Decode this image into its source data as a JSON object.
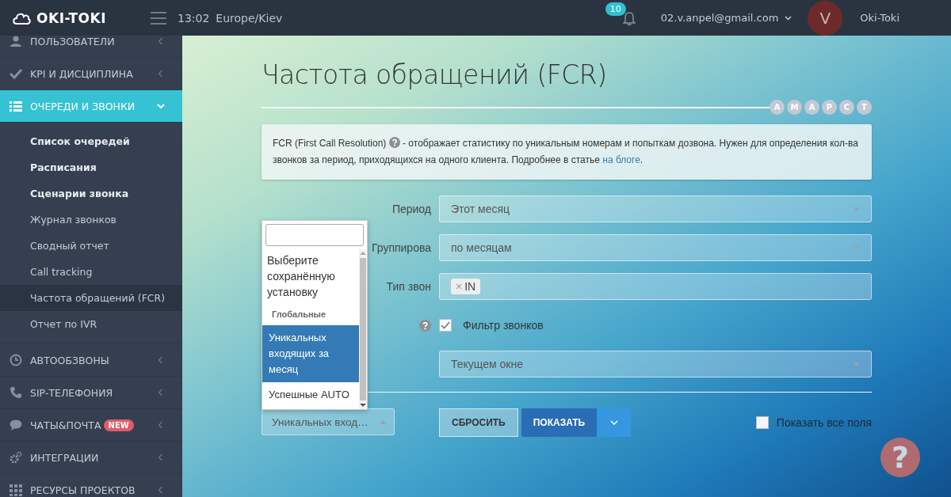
{
  "header": {
    "logo": "OKI-TOKI",
    "time": "13:02",
    "timezone": "Europe/Kiev",
    "notifications": "10",
    "email": "02.v.anpel@gmail.com",
    "avatar_letter": "V",
    "account": "Oki-Toki"
  },
  "sidebar": {
    "items": [
      {
        "label": "ПОЛЬЗОВАТЕЛИ",
        "expanded": false,
        "selected": false
      },
      {
        "label": "KPI И ДИСЦИПЛИНА",
        "expanded": false,
        "selected": false
      },
      {
        "label": "ОЧЕРЕДИ И ЗВОНКИ",
        "expanded": true,
        "selected": true,
        "children": [
          {
            "label": "Список очередей",
            "bold": true,
            "selected": false
          },
          {
            "label": "Расписания",
            "bold": true,
            "selected": false
          },
          {
            "label": "Сценарии звонка",
            "bold": true,
            "selected": false
          },
          {
            "label": "Журнал звонков",
            "bold": false,
            "selected": false
          },
          {
            "label": "Сводный отчет",
            "bold": false,
            "selected": false
          },
          {
            "label": "Call tracking",
            "bold": false,
            "selected": false
          },
          {
            "label": "Частота обращений (FCR)",
            "bold": false,
            "selected": true
          },
          {
            "label": "Отчет по IVR",
            "bold": false,
            "selected": false
          }
        ]
      },
      {
        "label": "АВТООБЗВОНЫ",
        "expanded": false,
        "selected": false
      },
      {
        "label": "SIP-ТЕЛЕФОНИЯ",
        "expanded": false,
        "selected": false
      },
      {
        "label": "ЧАТЫ&ПОЧТА",
        "badge": "NEW",
        "expanded": false,
        "selected": false
      },
      {
        "label": "ИНТЕГРАЦИИ",
        "expanded": false,
        "selected": false
      },
      {
        "label": "РЕСУРСЫ ПРОЕКТОВ",
        "expanded": false,
        "selected": false
      }
    ]
  },
  "page": {
    "title": "Частота обращений (FCR)",
    "steps": [
      "А",
      "М",
      "А",
      "Р",
      "С",
      "Т"
    ],
    "info": {
      "text_before": "FCR (First Call Resolution)",
      "text_after": " - отображает статистику по уникальным номерам и попыткам дозвона. Нужен для определения кол-ва звонков за период, приходящихся на одного клиента. Подробнее в статье ",
      "link": "на блоге",
      "text_end": "."
    },
    "rows": [
      {
        "kind": "select",
        "label": "Период",
        "value": "Этот месяц"
      },
      {
        "kind": "select",
        "label": "Группирова",
        "value": "по месяцам"
      },
      {
        "kind": "tags",
        "label": "Тип звон",
        "tags": [
          {
            "label": "IN",
            "remove": "×"
          }
        ]
      },
      {
        "kind": "checkbox",
        "help": true,
        "value": "Фильтр звонков",
        "checked": true
      },
      {
        "kind": "select",
        "value": "Текущем окне"
      }
    ],
    "preset": {
      "value": "Уникальных вход…",
      "open": true,
      "options": [
        {
          "kind": "placeholder",
          "label": "Выберите сохранённую установку",
          "selected": false
        },
        {
          "kind": "group",
          "label": "Глобальные"
        },
        {
          "kind": "option",
          "label": "Уникальных входящих за месяц",
          "selected": true
        },
        {
          "kind": "option",
          "label": "Успешные AUTO",
          "selected": false
        }
      ]
    },
    "reset_button": "СБРОСИТЬ",
    "show_button": "ПОКАЗАТЬ",
    "show_all": {
      "label": "Показать все поля",
      "checked": false
    },
    "help_button": "?"
  }
}
